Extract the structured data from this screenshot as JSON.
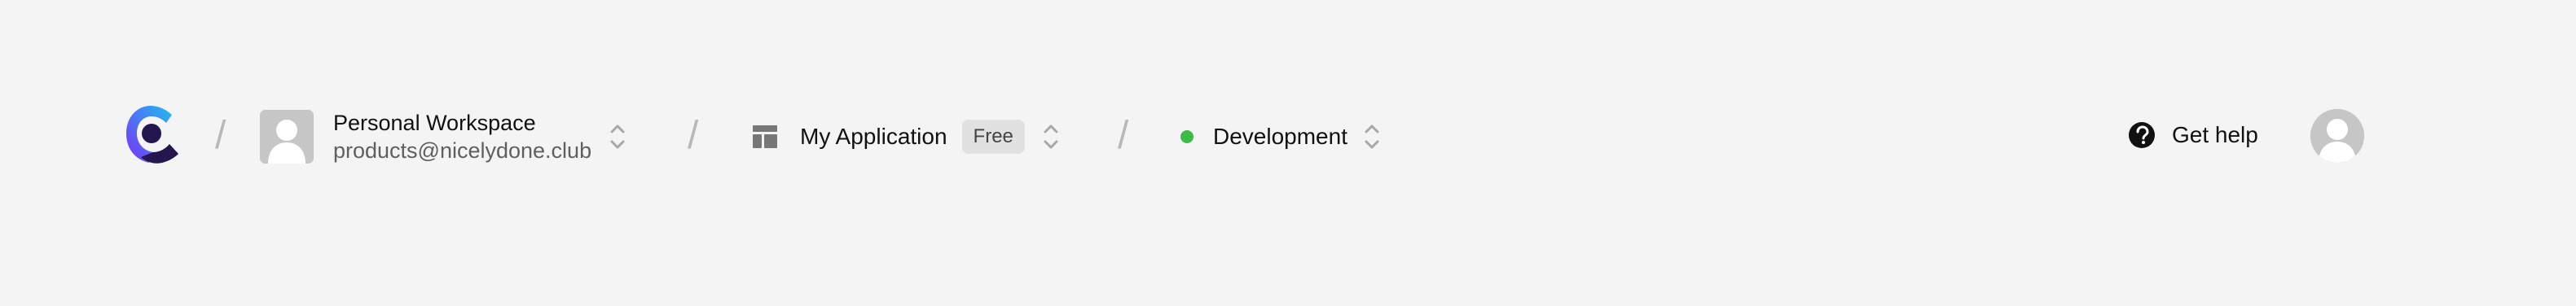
{
  "brand": {
    "logo_icon": "clerk-logo-icon",
    "gradient_start": "#7a2ff5",
    "gradient_end": "#20bdf3",
    "accent_dark": "#24164e"
  },
  "header": {
    "separator": "/"
  },
  "workspace": {
    "avatar_icon": "workspace-avatar-icon",
    "name": "Personal Workspace",
    "email": "products@nicelydone.club",
    "chevron_icon": "chevrons-up-down-icon"
  },
  "application": {
    "icon": "layout-icon",
    "name": "My Application",
    "plan_badge": "Free",
    "chevron_icon": "chevrons-up-down-icon"
  },
  "environment": {
    "status_color": "#3dbb47",
    "name": "Development",
    "chevron_icon": "chevrons-up-down-icon"
  },
  "help": {
    "icon": "question-circle-icon",
    "label": "Get help"
  },
  "user": {
    "avatar_icon": "user-avatar-icon"
  }
}
